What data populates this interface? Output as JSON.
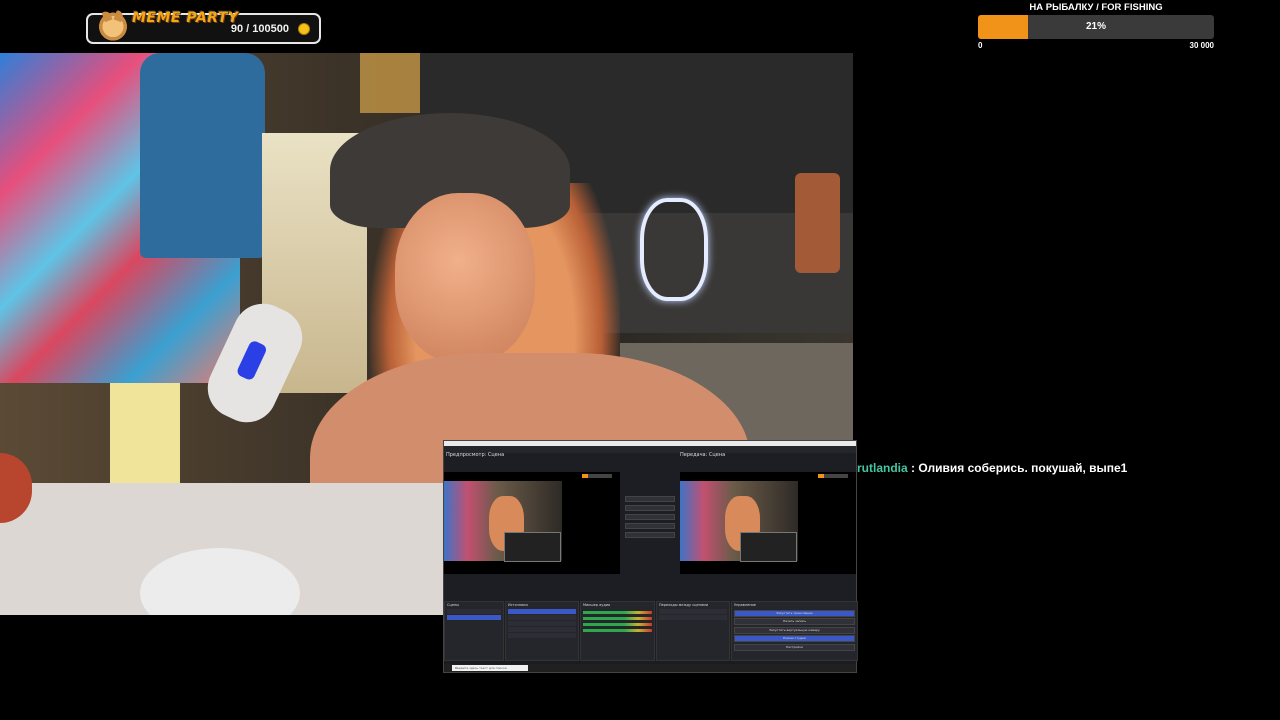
{
  "meme_widget": {
    "title": "MEME PARTY",
    "count": "90 / 100500"
  },
  "fishing_goal": {
    "title": "НА РЫБАЛКУ / FOR FISHING",
    "percent_label": "21%",
    "progress": 0.21,
    "min": "0",
    "max": "30 000",
    "colors": {
      "fill": "#f09318",
      "track": "#3a3a3a"
    }
  },
  "obs": {
    "preview_label": "Предпросмотр: Сцена",
    "program_label": "Передача: Сцена",
    "docks": [
      "Сцены",
      "Источники",
      "Микшер аудио",
      "Переходы между сценами",
      "Управление"
    ],
    "controls": [
      "Запустить трансляцию",
      "Начать запись",
      "Запустить виртуальную камеру",
      "Режим студии",
      "Настройки"
    ],
    "search_placeholder": "Введите здесь текст для поиска"
  },
  "chat": {
    "username": "rutlandia",
    "separator": ":",
    "message": "Оливия соберись. покушай, выпе1",
    "colors": {
      "username": "#45c6a0"
    }
  }
}
